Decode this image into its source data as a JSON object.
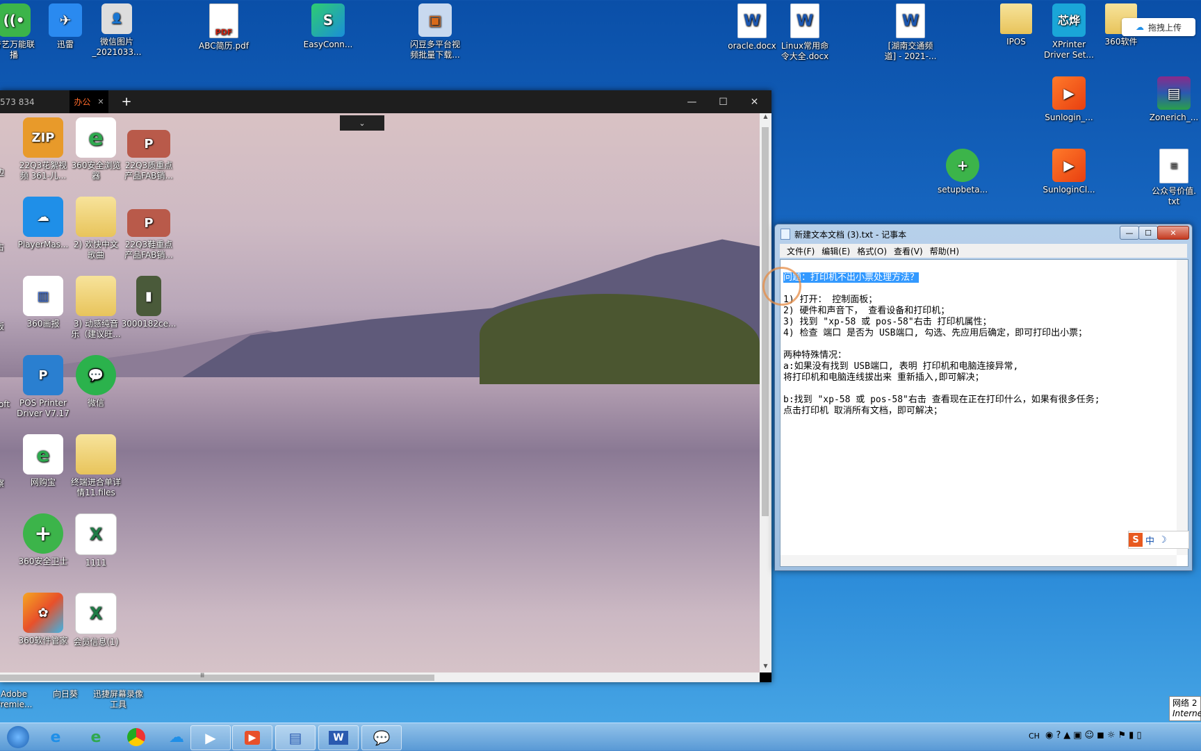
{
  "desktop_icons": [
    {
      "label": "奇艺万能联\n播",
      "icon": "iqiyi-icon"
    },
    {
      "label": "迅雷",
      "icon": "thunder-icon"
    },
    {
      "label": "微信图片\n_2021033...",
      "icon": "image-icon"
    },
    {
      "label": "ABC简历.pdf",
      "icon": "pdf-icon"
    },
    {
      "label": "EasyConn...",
      "icon": "easyconnect-icon"
    },
    {
      "label": "闪豆多平台视\n频批量下载...",
      "icon": "package-icon"
    },
    {
      "label": "oracle.docx",
      "icon": "word-doc-icon"
    },
    {
      "label": "Linux常用命\n令大全.docx",
      "icon": "word-doc-icon"
    },
    {
      "label": "[湖南交通频\n道] - 2021-...",
      "icon": "word-doc-icon"
    },
    {
      "label": "IPOS",
      "icon": "folder-icon"
    },
    {
      "label": "XPrinter\nDriver Set...",
      "icon": "xprinter-icon"
    },
    {
      "label": "360软件",
      "icon": "folder-icon"
    },
    {
      "label": "Sunlogin_...",
      "icon": "sunlogin-icon"
    },
    {
      "label": "Zonerich_...",
      "icon": "winrar-icon"
    },
    {
      "label": "setupbeta...",
      "icon": "setup-icon"
    },
    {
      "label": "SunloginCl...",
      "icon": "sunlogin-icon"
    },
    {
      "label": "公众号价值.\ntxt",
      "icon": "txt-icon"
    }
  ],
  "upload_button": "拖拽上传",
  "remote_window": {
    "tabs": [
      {
        "label": "573 834"
      },
      {
        "label": "办公"
      }
    ],
    "new_tab": "+",
    "controls": {
      "minimize": "—",
      "maximize": "☐",
      "close": "✕"
    },
    "dropdown": "⌄",
    "icons": [
      {
        "label": "22Q3花絮视\n频 361-儿...",
        "icon": "zip-icon",
        "color": "#e89a2a"
      },
      {
        "label": "360安全浏览\n器",
        "icon": "ie-icon",
        "color": "#2fa84f"
      },
      {
        "label": "22Q3质重点\n产品FAB销...",
        "icon": "ppt-icon",
        "color": "#c44"
      },
      {
        "label": "PlayerMas...",
        "icon": "cloud-icon",
        "color": "#1f8fe8"
      },
      {
        "label": "2) 欢快中文\n歌曲",
        "icon": "folder-icon",
        "color": "#e8c45b"
      },
      {
        "label": "22Q3鞋重点\n产品FAB销...",
        "icon": "ppt-icon",
        "color": "#c44"
      },
      {
        "label": "360画报",
        "icon": "news-icon",
        "color": "#3a6fe0"
      },
      {
        "label": "3) 动感纯音\n乐（建议旺...",
        "icon": "folder-icon",
        "color": "#e8c45b"
      },
      {
        "label": "3000182ce...",
        "icon": "image-icon",
        "color": "#667"
      },
      {
        "label": "POS Printer\nDriver V7.17",
        "icon": "pos-icon",
        "color": "#2a7fd0"
      },
      {
        "label": "微信",
        "icon": "wechat-icon",
        "color": "#2bb24c"
      },
      {
        "label": "网购宝",
        "icon": "ie-icon",
        "color": "#2fa84f"
      },
      {
        "label": "终端进合单详\n情11.files",
        "icon": "folder-icon",
        "color": "#e8c45b"
      },
      {
        "label": "360安全卫士",
        "icon": "shield-plus-icon",
        "color": "#3cb44a"
      },
      {
        "label": "1111",
        "icon": "excel-icon",
        "color": "#1e7b45"
      },
      {
        "label": "360软件管家",
        "icon": "apps-icon",
        "color": "#e8502a"
      },
      {
        "label": "会员信息(1)",
        "icon": "excel-icon",
        "color": "#1e7b45"
      }
    ],
    "edge_labels": [
      "边",
      "占",
      "板",
      "oft",
      "察"
    ],
    "scroll_glyph": "Ⅲ"
  },
  "bottom_desktop_icons": [
    {
      "label": "Adobe\nPremie..."
    },
    {
      "label": "向日葵"
    },
    {
      "label": "迅捷屏幕录像\n工具"
    }
  ],
  "notepad": {
    "title": "新建文本文档 (3).txt - 记事本",
    "menu": [
      "文件(F)",
      "编辑(E)",
      "格式(O)",
      "查看(V)",
      "帮助(H)"
    ],
    "lines": [
      "问题：打印机不出小票处理方法？",
      "",
      "1) 打开： 控制面板；",
      "2) 硬件和声音下， 查看设备和打印机；",
      "3) 找到 \"xp-58 或 pos-58\"右击 打印机属性；",
      "4) 检查 端口 是否为 USB端口, 勾选、先应用后确定，即可打印出小票；",
      "",
      "两种特殊情况：",
      "a:如果没有找到 USB端口, 表明 打印机和电脑连接异常,",
      "将打印机和电脑连线拔出来 重新插入,即可解决；",
      "",
      "b:找到 \"xp-58 或 pos-58\"右击 查看现在正在打印什么，如果有很多任务;",
      "点击打印机 取消所有文档，即可解决；"
    ],
    "ime": "中"
  },
  "taskbar": {
    "items": [
      "start",
      "ie",
      "360browser",
      "chrome",
      "baidu-netdisk",
      "video",
      "sunlogin",
      "notepad",
      "word",
      "wechat"
    ],
    "tray": {
      "lang": "CH",
      "network_popup": "网络 2",
      "network_popup_sub": "Interne"
    }
  },
  "colors": {
    "selection": "#3399ff",
    "tab_active": "#ff6a2a"
  }
}
